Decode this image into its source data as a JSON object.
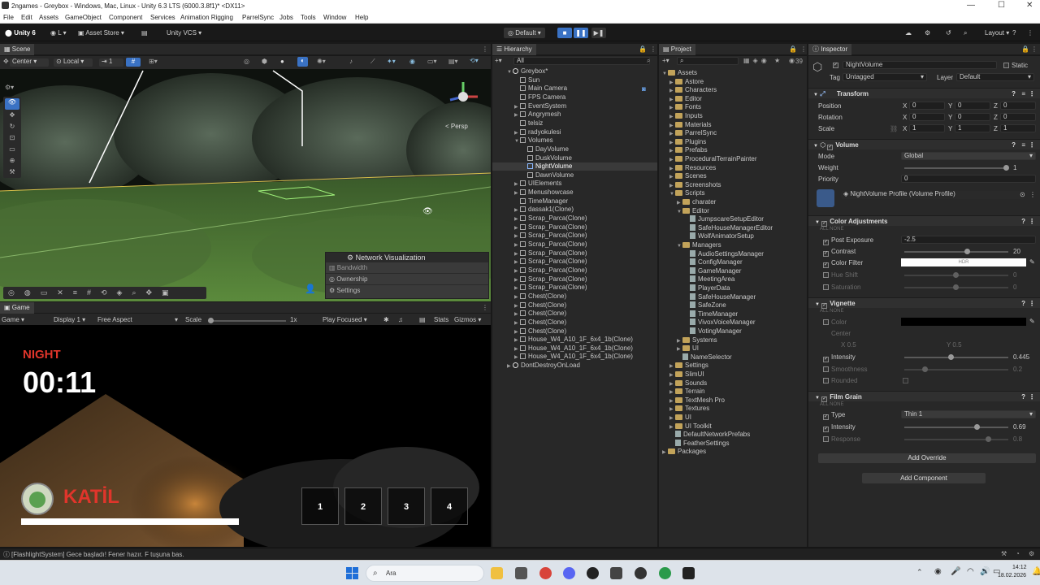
{
  "window": {
    "title": "2ngames - Greybox - Windows, Mac, Linux - Unity 6.3 LTS (6000.3.8f1)* <DX11>"
  },
  "menu": [
    "File",
    "Edit",
    "Assets",
    "GameObject",
    "Component",
    "Services",
    "Animation Rigging",
    "ParrelSync",
    "Jobs",
    "Tools",
    "Window",
    "Help"
  ],
  "toolbar": {
    "account": "Unity 6",
    "user": "L",
    "asset_store": "Asset Store",
    "vcs": "Unity VCS",
    "play_mode": "Default",
    "layout": "Layout"
  },
  "scene": {
    "tab": "Scene",
    "pivot": "Center",
    "space": "Local",
    "snap": "1",
    "persp": "< Persp",
    "netviz": {
      "title": "Network Visualization",
      "items": [
        "Bandwidth",
        "Ownership",
        "Settings"
      ]
    }
  },
  "game": {
    "tab": "Game",
    "display": "Game",
    "display_n": "Display 1",
    "aspect": "Free Aspect",
    "scale_label": "Scale",
    "scale_val": "1x",
    "play_focused": "Play Focused",
    "stats": "Stats",
    "gizmos": "Gizmos",
    "hud": {
      "phase": "NIGHT",
      "timer": "00:11",
      "role": "KATİL",
      "slots": [
        "1",
        "2",
        "3",
        "4"
      ]
    }
  },
  "hierarchy": {
    "tab": "Hierarchy",
    "search": "All",
    "items": [
      {
        "d": 0,
        "t": "Greybox*",
        "k": "unity",
        "e": "open"
      },
      {
        "d": 1,
        "t": "Sun",
        "k": "cube"
      },
      {
        "d": 1,
        "t": "Main Camera",
        "k": "cube"
      },
      {
        "d": 1,
        "t": "FPS Camera",
        "k": "cube"
      },
      {
        "d": 1,
        "t": "EventSystem",
        "k": "cube",
        "e": "closed"
      },
      {
        "d": 1,
        "t": "Angrymesh",
        "k": "cube",
        "e": "closed"
      },
      {
        "d": 1,
        "t": "telsiz",
        "k": "cube"
      },
      {
        "d": 1,
        "t": "radyokulesi",
        "k": "cube",
        "e": "closed"
      },
      {
        "d": 1,
        "t": "Volumes",
        "k": "cube",
        "e": "open"
      },
      {
        "d": 2,
        "t": "DayVolume",
        "k": "cube"
      },
      {
        "d": 2,
        "t": "DuskVolume",
        "k": "cube"
      },
      {
        "d": 2,
        "t": "NightVolume",
        "k": "cube",
        "sel": true
      },
      {
        "d": 2,
        "t": "DawnVolume",
        "k": "cube"
      },
      {
        "d": 1,
        "t": "UIElements",
        "k": "cube",
        "e": "closed"
      },
      {
        "d": 1,
        "t": "Menushowcase",
        "k": "cube",
        "e": "closed"
      },
      {
        "d": 1,
        "t": "TimeManager",
        "k": "cube"
      },
      {
        "d": 1,
        "t": "dassak1(Clone)",
        "k": "cube",
        "e": "closed"
      },
      {
        "d": 1,
        "t": "Scrap_Parca(Clone)",
        "k": "cube",
        "e": "closed"
      },
      {
        "d": 1,
        "t": "Scrap_Parca(Clone)",
        "k": "cube",
        "e": "closed"
      },
      {
        "d": 1,
        "t": "Scrap_Parca(Clone)",
        "k": "cube",
        "e": "closed"
      },
      {
        "d": 1,
        "t": "Scrap_Parca(Clone)",
        "k": "cube",
        "e": "closed"
      },
      {
        "d": 1,
        "t": "Scrap_Parca(Clone)",
        "k": "cube",
        "e": "closed"
      },
      {
        "d": 1,
        "t": "Scrap_Parca(Clone)",
        "k": "cube",
        "e": "closed"
      },
      {
        "d": 1,
        "t": "Scrap_Parca(Clone)",
        "k": "cube",
        "e": "closed"
      },
      {
        "d": 1,
        "t": "Scrap_Parca(Clone)",
        "k": "cube",
        "e": "closed"
      },
      {
        "d": 1,
        "t": "Scrap_Parca(Clone)",
        "k": "cube",
        "e": "closed"
      },
      {
        "d": 1,
        "t": "Chest(Clone)",
        "k": "cube",
        "e": "closed"
      },
      {
        "d": 1,
        "t": "Chest(Clone)",
        "k": "cube",
        "e": "closed"
      },
      {
        "d": 1,
        "t": "Chest(Clone)",
        "k": "cube",
        "e": "closed"
      },
      {
        "d": 1,
        "t": "Chest(Clone)",
        "k": "cube",
        "e": "closed"
      },
      {
        "d": 1,
        "t": "Chest(Clone)",
        "k": "cube",
        "e": "closed"
      },
      {
        "d": 1,
        "t": "House_W4_A10_1F_6x4_1b(Clone)",
        "k": "cube",
        "e": "closed"
      },
      {
        "d": 1,
        "t": "House_W4_A10_1F_6x4_1b(Clone)",
        "k": "cube",
        "e": "closed"
      },
      {
        "d": 1,
        "t": "House_W4_A10_1F_6x4_1b(Clone)",
        "k": "cube",
        "e": "closed"
      },
      {
        "d": 0,
        "t": "DontDestroyOnLoad",
        "k": "unity",
        "e": "closed"
      }
    ]
  },
  "project": {
    "tab": "Project",
    "count": "39",
    "items": [
      {
        "d": 0,
        "t": "Assets",
        "k": "fold",
        "e": "open"
      },
      {
        "d": 1,
        "t": "Astore",
        "k": "fold",
        "e": "closed"
      },
      {
        "d": 1,
        "t": "Characters",
        "k": "fold",
        "e": "closed"
      },
      {
        "d": 1,
        "t": "Editor",
        "k": "fold",
        "e": "closed"
      },
      {
        "d": 1,
        "t": "Fonts",
        "k": "fold",
        "e": "closed"
      },
      {
        "d": 1,
        "t": "Inputs",
        "k": "fold",
        "e": "closed"
      },
      {
        "d": 1,
        "t": "Materials",
        "k": "fold",
        "e": "closed"
      },
      {
        "d": 1,
        "t": "ParrelSync",
        "k": "fold",
        "e": "closed"
      },
      {
        "d": 1,
        "t": "Plugins",
        "k": "fold",
        "e": "closed"
      },
      {
        "d": 1,
        "t": "Prefabs",
        "k": "fold",
        "e": "closed"
      },
      {
        "d": 1,
        "t": "ProceduralTerrainPainter",
        "k": "fold",
        "e": "closed"
      },
      {
        "d": 1,
        "t": "Resources",
        "k": "fold",
        "e": "closed"
      },
      {
        "d": 1,
        "t": "Scenes",
        "k": "fold",
        "e": "closed"
      },
      {
        "d": 1,
        "t": "Screenshots",
        "k": "fold",
        "e": "closed"
      },
      {
        "d": 1,
        "t": "Scripts",
        "k": "fold",
        "e": "open"
      },
      {
        "d": 2,
        "t": "charater",
        "k": "fold",
        "e": "closed"
      },
      {
        "d": 2,
        "t": "Editor",
        "k": "fold",
        "e": "open"
      },
      {
        "d": 3,
        "t": "JumpscareSetupEditor",
        "k": "scr"
      },
      {
        "d": 3,
        "t": "SafeHouseManagerEditor",
        "k": "scr"
      },
      {
        "d": 3,
        "t": "WolfAnimatorSetup",
        "k": "scr"
      },
      {
        "d": 2,
        "t": "Managers",
        "k": "fold",
        "e": "open"
      },
      {
        "d": 3,
        "t": "AudioSettingsManager",
        "k": "scr"
      },
      {
        "d": 3,
        "t": "ConfigManager",
        "k": "scr"
      },
      {
        "d": 3,
        "t": "GameManager",
        "k": "scr"
      },
      {
        "d": 3,
        "t": "MeetingArea",
        "k": "scr"
      },
      {
        "d": 3,
        "t": "PlayerData",
        "k": "scr"
      },
      {
        "d": 3,
        "t": "SafeHouseManager",
        "k": "scr"
      },
      {
        "d": 3,
        "t": "SafeZone",
        "k": "scr"
      },
      {
        "d": 3,
        "t": "TimeManager",
        "k": "scr"
      },
      {
        "d": 3,
        "t": "VivoxVoiceManager",
        "k": "scr"
      },
      {
        "d": 3,
        "t": "VotingManager",
        "k": "scr"
      },
      {
        "d": 2,
        "t": "Systems",
        "k": "fold",
        "e": "closed"
      },
      {
        "d": 2,
        "t": "UI",
        "k": "fold",
        "e": "closed"
      },
      {
        "d": 2,
        "t": "NameSelector",
        "k": "scr"
      },
      {
        "d": 1,
        "t": "Settings",
        "k": "fold",
        "e": "closed"
      },
      {
        "d": 1,
        "t": "SlimUI",
        "k": "fold",
        "e": "closed"
      },
      {
        "d": 1,
        "t": "Sounds",
        "k": "fold",
        "e": "closed"
      },
      {
        "d": 1,
        "t": "Terrain",
        "k": "fold",
        "e": "closed"
      },
      {
        "d": 1,
        "t": "TextMesh Pro",
        "k": "fold",
        "e": "closed"
      },
      {
        "d": 1,
        "t": "Textures",
        "k": "fold",
        "e": "closed"
      },
      {
        "d": 1,
        "t": "UI",
        "k": "fold",
        "e": "closed"
      },
      {
        "d": 1,
        "t": "UI Toolkit",
        "k": "fold",
        "e": "closed"
      },
      {
        "d": 1,
        "t": "DefaultNetworkPrefabs",
        "k": "scr"
      },
      {
        "d": 1,
        "t": "FeatherSettings",
        "k": "scr"
      },
      {
        "d": 0,
        "t": "Packages",
        "k": "fold",
        "e": "closed"
      }
    ]
  },
  "inspector": {
    "tab": "Inspector",
    "name": "NightVolume",
    "static": "Static",
    "tag_label": "Tag",
    "tag": "Untagged",
    "layer_label": "Layer",
    "layer": "Default",
    "transform": {
      "title": "Transform",
      "position": "Position",
      "rotation": "Rotation",
      "scale": "Scale",
      "px": "0",
      "py": "0",
      "pz": "0",
      "rx": "0",
      "ry": "0",
      "rz": "0",
      "sx": "1",
      "sy": "1",
      "sz": "1"
    },
    "volume": {
      "title": "Volume",
      "mode_label": "Mode",
      "mode": "Global",
      "weight_label": "Weight",
      "weight": "1",
      "priority_label": "Priority",
      "priority": "0",
      "profile": "NightVolume Profile (Volume Profile)"
    },
    "color_adj": {
      "title": "Color Adjustments",
      "all": "ALL",
      "none": "NONE",
      "post_exposure": "Post Exposure",
      "pe_val": "-2.5",
      "contrast": "Contrast",
      "contrast_val": "20",
      "color_filter": "Color Filter",
      "hdr": "HDR",
      "hue_shift": "Hue Shift",
      "hue_val": "0",
      "saturation": "Saturation",
      "sat_val": "0"
    },
    "vignette": {
      "title": "Vignette",
      "color": "Color",
      "center": "Center",
      "cx": "0.5",
      "cy": "0.5",
      "intensity": "Intensity",
      "int_val": "0.445",
      "smoothness": "Smoothness",
      "smooth_val": "0.2",
      "rounded": "Rounded"
    },
    "film_grain": {
      "title": "Film Grain",
      "type_label": "Type",
      "type": "Thin 1",
      "intensity": "Intensity",
      "int_val": "0.69",
      "response": "Response",
      "resp_val": "0.8"
    },
    "add_override": "Add Override",
    "add_component": "Add Component"
  },
  "status": {
    "message": "[FlashlightSystem] Gece başladı! Fener hazır. F tuşuna bas."
  },
  "taskbar": {
    "search": "Ara",
    "time": "14:12",
    "date": "18.02.2026"
  },
  "colors": {
    "hud_red": "#e0352b",
    "accent": "#3a72c4",
    "panel": "#282828"
  }
}
